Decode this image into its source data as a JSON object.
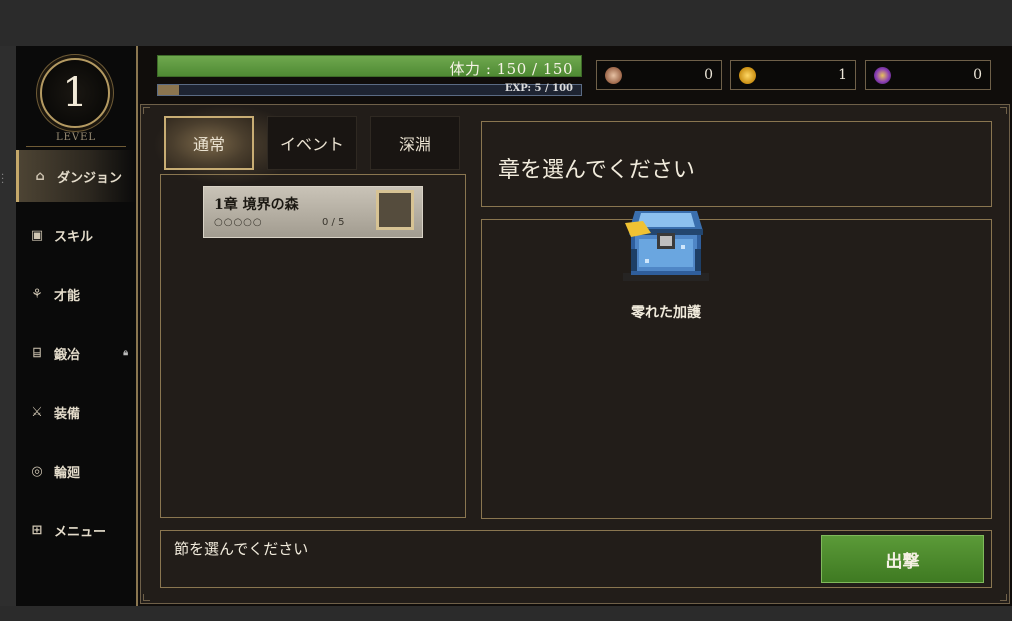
{
  "player": {
    "level": "1",
    "level_label": "LEVEL"
  },
  "sidebar": {
    "items": [
      {
        "label": "ダンジョン",
        "icon": "dungeon-icon",
        "glyph": "⌂",
        "active": true
      },
      {
        "label": "スキル",
        "icon": "skill-icon",
        "glyph": "▣",
        "active": false
      },
      {
        "label": "才能",
        "icon": "talent-icon",
        "glyph": "⚘",
        "active": false
      },
      {
        "label": "鍛冶",
        "icon": "anvil-icon",
        "glyph": "⌸",
        "active": false,
        "locked": true
      },
      {
        "label": "装備",
        "icon": "sword-icon",
        "glyph": "⚔",
        "active": false
      },
      {
        "label": "輪廻",
        "icon": "cycle-icon",
        "glyph": "◎",
        "active": false
      },
      {
        "label": "メニュー",
        "icon": "menu-grid-icon",
        "glyph": "⊞",
        "active": false
      }
    ]
  },
  "status": {
    "hp_text": "体力 : 150 / 150",
    "hp_fraction": 1.0,
    "exp_text": "EXP: 5 / 100",
    "exp_fraction": 0.05
  },
  "resources": [
    {
      "icon": "crystal-orb-icon",
      "value": "0",
      "color": "#b07a5a"
    },
    {
      "icon": "gold-coin-icon",
      "value": "1",
      "color": "#d7a21c"
    },
    {
      "icon": "purple-gem-icon",
      "value": "0",
      "color": "#8a3fb5"
    }
  ],
  "tabs": [
    {
      "label": "通常",
      "active": true
    },
    {
      "label": "イベント",
      "active": false
    },
    {
      "label": "深淵",
      "active": false
    }
  ],
  "chapters": [
    {
      "title": "1章 境界の森",
      "dots": "○○○○○",
      "progress": "0 / 5"
    }
  ],
  "chapter_prompt": "章を選んでください",
  "treasure": {
    "label": "零れた加護",
    "icon": "treasure-chest-icon"
  },
  "section_prompt": "節を選んでください",
  "go_button_label": "出撃"
}
